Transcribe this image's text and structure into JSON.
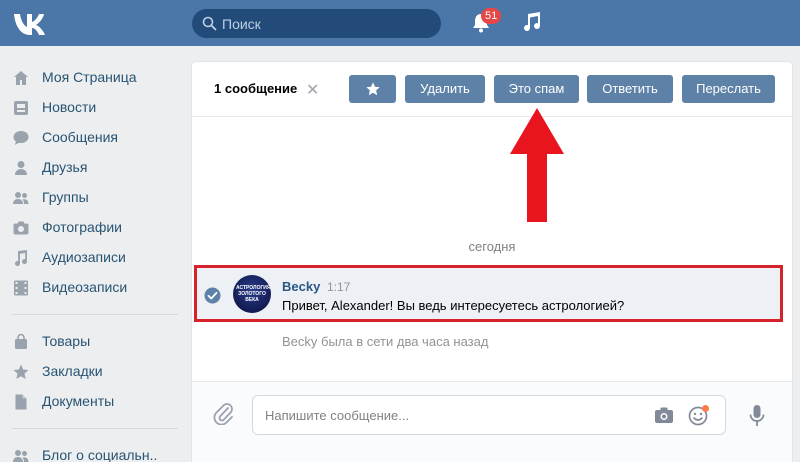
{
  "header": {
    "logo_icon": "vk-logo-icon",
    "search": {
      "placeholder": "Поиск",
      "icon": "search-icon"
    },
    "notifications": {
      "icon": "bell-icon",
      "badge": "51"
    },
    "music_icon": "music-note-icon"
  },
  "sidebar": {
    "items": [
      {
        "label": "Моя Страница",
        "icon": "home-icon"
      },
      {
        "label": "Новости",
        "icon": "news-icon"
      },
      {
        "label": "Сообщения",
        "icon": "messages-icon"
      },
      {
        "label": "Друзья",
        "icon": "friend-icon"
      },
      {
        "label": "Группы",
        "icon": "groups-icon"
      },
      {
        "label": "Фотографии",
        "icon": "camera-icon"
      },
      {
        "label": "Аудиозаписи",
        "icon": "music-note-icon"
      },
      {
        "label": "Видеозаписи",
        "icon": "film-icon"
      },
      {
        "label": "Товары",
        "icon": "bag-icon"
      },
      {
        "label": "Закладки",
        "icon": "star-icon"
      },
      {
        "label": "Документы",
        "icon": "document-icon"
      },
      {
        "label": "Блог о социальн..",
        "icon": "groups-icon"
      }
    ]
  },
  "toolbar": {
    "selection_count": "1 сообщение",
    "clear_glyph": "✕",
    "star_icon": "star-icon",
    "delete_label": "Удалить",
    "spam_label": "Это спам",
    "reply_label": "Ответить",
    "forward_label": "Переслать"
  },
  "annotation": {
    "arrow_color": "#e8141e"
  },
  "chat": {
    "date_label": "сегодня",
    "message": {
      "sender": "Becky",
      "time": "1:17",
      "text": "Привет, Alexander! Вы ведь интересуетесь астрологией?",
      "avatar_text": "АСТРОЛОГИЯ ЗОЛОТОГО ВЕКА",
      "highlight_color": "#d6222a"
    },
    "last_seen": "Becky была в сети два часа назад"
  },
  "composer": {
    "placeholder": "Напишите сообщение...",
    "attach_icon": "paperclip-icon",
    "camera_icon": "camera-icon",
    "emoji_icon": "smile-icon",
    "mic_icon": "microphone-icon"
  },
  "colors": {
    "header": "#4a76a8",
    "button": "#5e81a8",
    "link": "#2a5885",
    "sidebar_text": "#285473",
    "page_bg": "#edeef0"
  }
}
